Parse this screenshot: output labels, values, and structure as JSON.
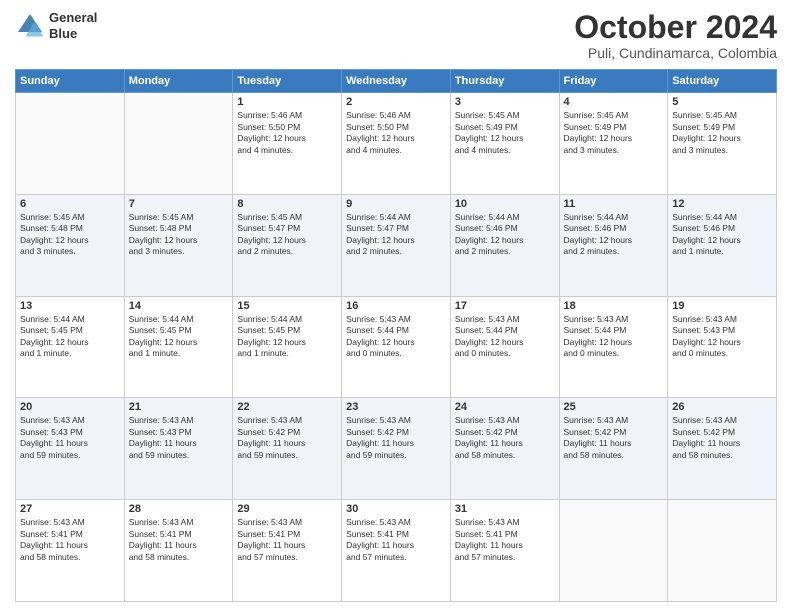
{
  "header": {
    "logo_line1": "General",
    "logo_line2": "Blue",
    "month": "October 2024",
    "location": "Puli, Cundinamarca, Colombia"
  },
  "weekdays": [
    "Sunday",
    "Monday",
    "Tuesday",
    "Wednesday",
    "Thursday",
    "Friday",
    "Saturday"
  ],
  "weeks": [
    [
      {
        "day": "",
        "info": ""
      },
      {
        "day": "",
        "info": ""
      },
      {
        "day": "1",
        "info": "Sunrise: 5:46 AM\nSunset: 5:50 PM\nDaylight: 12 hours\nand 4 minutes."
      },
      {
        "day": "2",
        "info": "Sunrise: 5:46 AM\nSunset: 5:50 PM\nDaylight: 12 hours\nand 4 minutes."
      },
      {
        "day": "3",
        "info": "Sunrise: 5:45 AM\nSunset: 5:49 PM\nDaylight: 12 hours\nand 4 minutes."
      },
      {
        "day": "4",
        "info": "Sunrise: 5:45 AM\nSunset: 5:49 PM\nDaylight: 12 hours\nand 3 minutes."
      },
      {
        "day": "5",
        "info": "Sunrise: 5:45 AM\nSunset: 5:49 PM\nDaylight: 12 hours\nand 3 minutes."
      }
    ],
    [
      {
        "day": "6",
        "info": "Sunrise: 5:45 AM\nSunset: 5:48 PM\nDaylight: 12 hours\nand 3 minutes."
      },
      {
        "day": "7",
        "info": "Sunrise: 5:45 AM\nSunset: 5:48 PM\nDaylight: 12 hours\nand 3 minutes."
      },
      {
        "day": "8",
        "info": "Sunrise: 5:45 AM\nSunset: 5:47 PM\nDaylight: 12 hours\nand 2 minutes."
      },
      {
        "day": "9",
        "info": "Sunrise: 5:44 AM\nSunset: 5:47 PM\nDaylight: 12 hours\nand 2 minutes."
      },
      {
        "day": "10",
        "info": "Sunrise: 5:44 AM\nSunset: 5:46 PM\nDaylight: 12 hours\nand 2 minutes."
      },
      {
        "day": "11",
        "info": "Sunrise: 5:44 AM\nSunset: 5:46 PM\nDaylight: 12 hours\nand 2 minutes."
      },
      {
        "day": "12",
        "info": "Sunrise: 5:44 AM\nSunset: 5:46 PM\nDaylight: 12 hours\nand 1 minute."
      }
    ],
    [
      {
        "day": "13",
        "info": "Sunrise: 5:44 AM\nSunset: 5:45 PM\nDaylight: 12 hours\nand 1 minute."
      },
      {
        "day": "14",
        "info": "Sunrise: 5:44 AM\nSunset: 5:45 PM\nDaylight: 12 hours\nand 1 minute."
      },
      {
        "day": "15",
        "info": "Sunrise: 5:44 AM\nSunset: 5:45 PM\nDaylight: 12 hours\nand 1 minute."
      },
      {
        "day": "16",
        "info": "Sunrise: 5:43 AM\nSunset: 5:44 PM\nDaylight: 12 hours\nand 0 minutes."
      },
      {
        "day": "17",
        "info": "Sunrise: 5:43 AM\nSunset: 5:44 PM\nDaylight: 12 hours\nand 0 minutes."
      },
      {
        "day": "18",
        "info": "Sunrise: 5:43 AM\nSunset: 5:44 PM\nDaylight: 12 hours\nand 0 minutes."
      },
      {
        "day": "19",
        "info": "Sunrise: 5:43 AM\nSunset: 5:43 PM\nDaylight: 12 hours\nand 0 minutes."
      }
    ],
    [
      {
        "day": "20",
        "info": "Sunrise: 5:43 AM\nSunset: 5:43 PM\nDaylight: 11 hours\nand 59 minutes."
      },
      {
        "day": "21",
        "info": "Sunrise: 5:43 AM\nSunset: 5:43 PM\nDaylight: 11 hours\nand 59 minutes."
      },
      {
        "day": "22",
        "info": "Sunrise: 5:43 AM\nSunset: 5:42 PM\nDaylight: 11 hours\nand 59 minutes."
      },
      {
        "day": "23",
        "info": "Sunrise: 5:43 AM\nSunset: 5:42 PM\nDaylight: 11 hours\nand 59 minutes."
      },
      {
        "day": "24",
        "info": "Sunrise: 5:43 AM\nSunset: 5:42 PM\nDaylight: 11 hours\nand 58 minutes."
      },
      {
        "day": "25",
        "info": "Sunrise: 5:43 AM\nSunset: 5:42 PM\nDaylight: 11 hours\nand 58 minutes."
      },
      {
        "day": "26",
        "info": "Sunrise: 5:43 AM\nSunset: 5:42 PM\nDaylight: 11 hours\nand 58 minutes."
      }
    ],
    [
      {
        "day": "27",
        "info": "Sunrise: 5:43 AM\nSunset: 5:41 PM\nDaylight: 11 hours\nand 58 minutes."
      },
      {
        "day": "28",
        "info": "Sunrise: 5:43 AM\nSunset: 5:41 PM\nDaylight: 11 hours\nand 58 minutes."
      },
      {
        "day": "29",
        "info": "Sunrise: 5:43 AM\nSunset: 5:41 PM\nDaylight: 11 hours\nand 57 minutes."
      },
      {
        "day": "30",
        "info": "Sunrise: 5:43 AM\nSunset: 5:41 PM\nDaylight: 11 hours\nand 57 minutes."
      },
      {
        "day": "31",
        "info": "Sunrise: 5:43 AM\nSunset: 5:41 PM\nDaylight: 11 hours\nand 57 minutes."
      },
      {
        "day": "",
        "info": ""
      },
      {
        "day": "",
        "info": ""
      }
    ]
  ]
}
